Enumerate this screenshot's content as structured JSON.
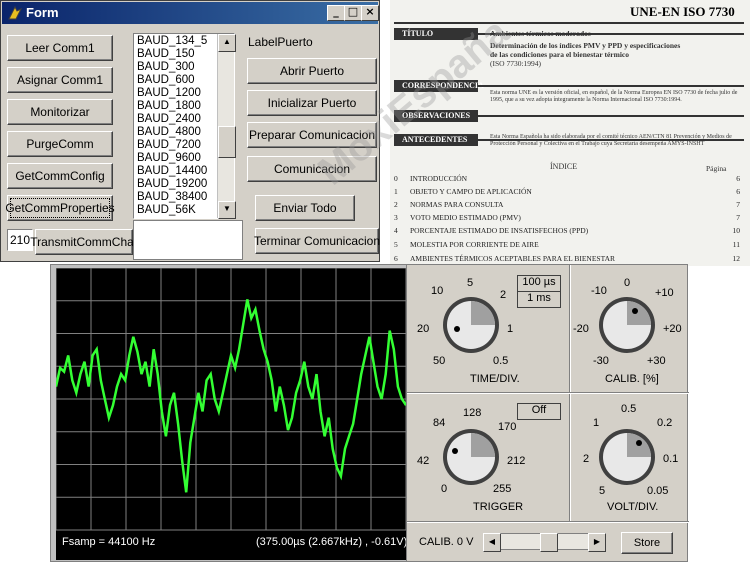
{
  "form": {
    "title": "Form",
    "buttons_left": [
      "Leer Comm1",
      "Asignar Comm1",
      "Monitorizar",
      "PurgeComm",
      "GetCommConfig",
      "GetCommProperties"
    ],
    "transmit_label": "TransmitCommChar",
    "text_value": "210",
    "baud_rates": [
      "BAUD_134_5",
      "BAUD_150",
      "BAUD_300",
      "BAUD_600",
      "BAUD_1200",
      "BAUD_1800",
      "BAUD_2400",
      "BAUD_4800",
      "BAUD_7200",
      "BAUD_9600",
      "BAUD_14400",
      "BAUD_19200",
      "BAUD_38400",
      "BAUD_56K"
    ],
    "label_puerto": "LabelPuerto",
    "buttons_right": [
      "Abrir Puerto",
      "Inicializar Puerto",
      "Preparar Comunicacion",
      "Comunicacion"
    ],
    "enviar_label": "Enviar Todo",
    "terminar_label": "Terminar Comunicacion"
  },
  "document": {
    "standard": "UNE-EN ISO 7730",
    "titulo_label": "TÍTULO",
    "titulo_line1": "Ambientes térmicos moderados",
    "titulo_line2": "Determinación de los índices PMV y PPD y especificaciones",
    "titulo_line3": "de las condiciones para el bienestar térmico",
    "titulo_line4": "(ISO 7730:1994)",
    "correspondencia_label": "CORRESPONDENCIA",
    "correspondencia_text": "Esta norma UNE es la versión oficial, en español, de la Norma Europea EN ISO 7730 de fecha julio de 1995, que a su vez adopta íntegramente la Norma Internacional ISO 7730:1994.",
    "observaciones_label": "OBSERVACIONES",
    "antecedentes_label": "ANTECEDENTES",
    "antecedentes_text": "Esta Norma Española ha sido elaborada por el comité técnico AEN/CTN 81 Prevención y Medios de Protección Personal y Colectiva en el Trabajo cuya Secretaría desempeña AMYS-INSHT",
    "indice_label": "ÍNDICE",
    "pagina_label": "Página",
    "toc": [
      {
        "n": "0",
        "t": "INTRODUCCIÓN",
        "p": "6"
      },
      {
        "n": "1",
        "t": "OBJETO Y CAMPO DE APLICACIÓN",
        "p": "6"
      },
      {
        "n": "2",
        "t": "NORMAS PARA CONSULTA",
        "p": "7"
      },
      {
        "n": "3",
        "t": "VOTO MEDIO ESTIMADO (PMV)",
        "p": "7"
      },
      {
        "n": "4",
        "t": "PORCENTAJE ESTIMADO DE INSATISFECHOS (PPD)",
        "p": "10"
      },
      {
        "n": "5",
        "t": "MOLESTIA POR CORRIENTE DE AIRE",
        "p": "11"
      },
      {
        "n": "6",
        "t": "AMBIENTES TÉRMICOS ACEPTABLES PARA EL BIENESTAR",
        "p": "12"
      }
    ]
  },
  "watermark": "MoxiEspaña",
  "scope": {
    "fsamp": "Fsamp = 44100 Hz",
    "cursor": "(375.00µs (2.667kHz) , -0.61V)",
    "waveform_y": [
      0.1,
      0.25,
      0.22,
      0.35,
      0.15,
      0.05,
      0.2,
      0.3,
      0.1,
      0.35,
      0.4,
      0.15,
      0.0,
      -0.15,
      -0.05,
      0.1,
      0.2,
      0.15,
      0.35,
      0.5,
      0.38,
      0.2,
      0.3,
      0.1,
      0.4,
      0.2,
      -0.1,
      -0.3,
      -0.05,
      0.05,
      -0.2,
      -0.5,
      -0.75,
      -0.35,
      -0.15,
      0.05,
      -0.1,
      0.15,
      0.2,
      0.0,
      -0.1,
      0.05,
      0.2,
      0.35,
      0.25,
      0.4,
      0.6,
      0.8,
      0.65,
      0.72,
      0.55,
      0.4,
      0.3,
      0.15,
      -0.1,
      0.1,
      -0.05,
      -0.25,
      -0.15,
      0.05,
      0.15,
      0.3,
      0.1,
      0.0,
      0.2,
      -0.1,
      -0.3,
      -0.15,
      -0.4,
      -0.55,
      -0.62,
      -0.4,
      -0.3,
      -0.2,
      0.0,
      0.2,
      0.35,
      0.5,
      0.3,
      0.1,
      0.0,
      0.2,
      0.55,
      0.4,
      0.1,
      0.0,
      -0.05
    ],
    "timediv": {
      "label": "TIME/DIV.",
      "btn1": "100 µs",
      "btn2": "1 ms",
      "ticks": [
        "10",
        "5",
        "2",
        "20",
        "1",
        "50",
        "0.5"
      ]
    },
    "calib_pct": {
      "label": "CALIB. [%]",
      "ticks": [
        "-10",
        "0",
        "+10",
        "-20",
        "+20",
        "-30",
        "+30"
      ]
    },
    "trigger": {
      "label": "TRIGGER",
      "btn": "Off",
      "ticks": [
        "84",
        "128",
        "170",
        "42",
        "212",
        "0",
        "255"
      ]
    },
    "voltdiv": {
      "label": "VOLT/DIV.",
      "ticks": [
        "1",
        "0.5",
        "0.2",
        "2",
        "0.1",
        "5",
        "0.05"
      ]
    },
    "calib_v": "CALIB. 0 V",
    "store": "Store"
  }
}
